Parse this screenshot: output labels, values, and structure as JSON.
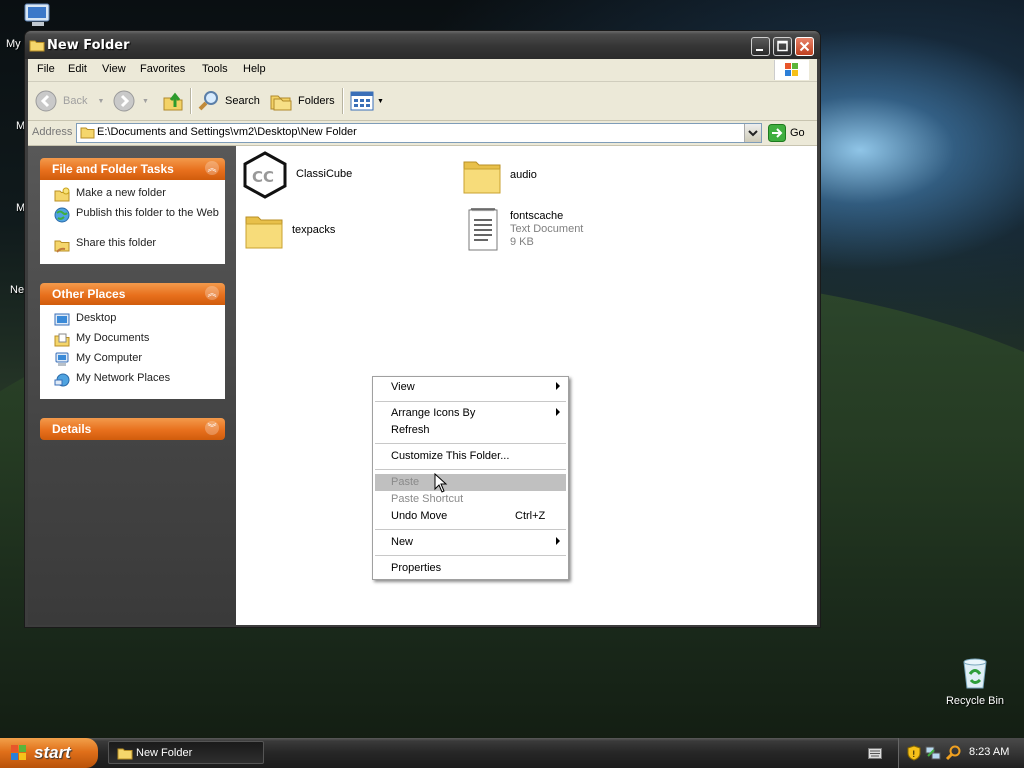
{
  "desktop": {
    "left_labels": [
      "My",
      "M",
      "M",
      "Ne"
    ],
    "recycle_bin_label": "Recycle Bin"
  },
  "window": {
    "title": "New Folder",
    "menu": [
      "File",
      "Edit",
      "View",
      "Favorites",
      "Tools",
      "Help"
    ],
    "toolbar": {
      "back": "Back",
      "search": "Search",
      "folders": "Folders"
    },
    "address": {
      "label": "Address",
      "path": "E:\\Documents and Settings\\vm2\\Desktop\\New Folder",
      "go": "Go"
    }
  },
  "taskpane": {
    "file_tasks": {
      "title": "File and Folder Tasks",
      "items": [
        "Make a new folder",
        "Publish this folder to the Web",
        "Share this folder"
      ]
    },
    "other_places": {
      "title": "Other Places",
      "items": [
        "Desktop",
        "My Documents",
        "My Computer",
        "My Network Places"
      ]
    },
    "details": {
      "title": "Details"
    }
  },
  "files": [
    {
      "name": "ClassiCube",
      "icon": "classicube-app-icon"
    },
    {
      "name": "audio",
      "icon": "folder-icon"
    },
    {
      "name": "texpacks",
      "icon": "folder-icon"
    },
    {
      "name": "fontscache",
      "type": "Text Document",
      "size": "9 KB",
      "icon": "text-document-icon"
    }
  ],
  "context_menu": {
    "view": "View",
    "arrange": "Arrange Icons By",
    "refresh": "Refresh",
    "customize": "Customize This Folder...",
    "paste": "Paste",
    "paste_shortcut": "Paste Shortcut",
    "undo": "Undo Move",
    "undo_shortcut": "Ctrl+Z",
    "new": "New",
    "properties": "Properties"
  },
  "taskbar": {
    "start": "start",
    "task_item": "New Folder",
    "clock": "8:23 AM"
  }
}
